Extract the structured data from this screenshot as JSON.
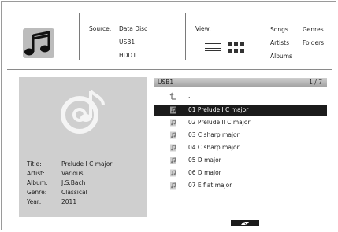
{
  "header": {
    "source_label": "Source:",
    "sources": [
      "Data Disc",
      "USB1",
      "HDD1"
    ],
    "view_label": "View:",
    "categories": [
      "Songs",
      "Genres",
      "Artists",
      "Folders",
      "Albums"
    ]
  },
  "info": {
    "labels": [
      "Title:",
      "Artist:",
      "Album:",
      "Genre:",
      "Year:"
    ],
    "values": [
      "Prelude I C major",
      "Various",
      "J.S.Bach",
      "Classical",
      "2011"
    ]
  },
  "list": {
    "path": "USB1",
    "counter": "1 / 7",
    "parent": "..",
    "items": [
      "01 Prelude I C major",
      "02 Prelude II C major",
      "03 C sharp major",
      "04 C sharp major",
      "05 D major",
      "06 D major",
      "07 E flat major"
    ]
  },
  "icons": {
    "app": "music-note-icon",
    "disc": "music-disc-icon",
    "parent": "folder-up-icon",
    "track": "music-file-icon",
    "view_list": "list-view-icon",
    "view_grid": "grid-view-icon",
    "scroll": "scroll-arrows-icon"
  },
  "colors": {
    "selected_row": "#1b1b1b",
    "panel": "#cfcfcf"
  }
}
